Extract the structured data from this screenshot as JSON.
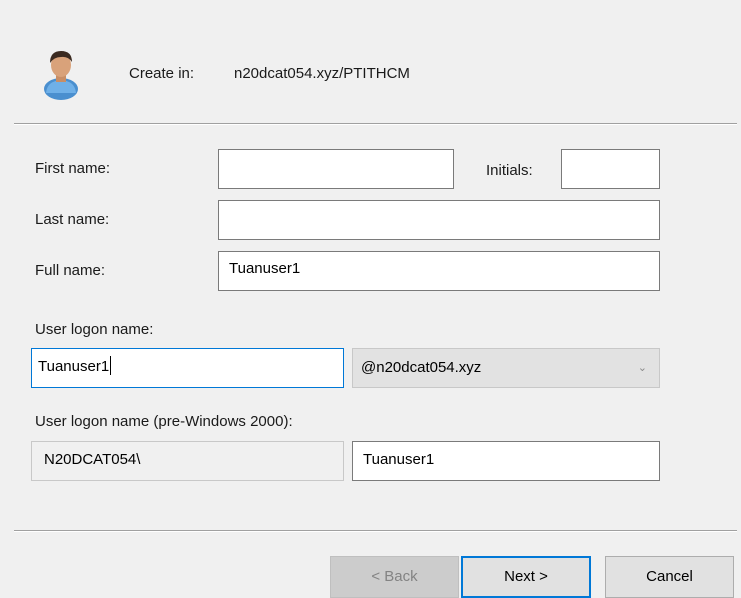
{
  "header": {
    "icon": "user-icon",
    "create_in_label": "Create in:",
    "create_in_path": "n20dcat054.xyz/PTITHCM"
  },
  "form": {
    "first_name": {
      "label": "First name:",
      "value": ""
    },
    "initials": {
      "label": "Initials:",
      "value": ""
    },
    "last_name": {
      "label": "Last name:",
      "value": ""
    },
    "full_name": {
      "label": "Full name:",
      "value": "Tuanuser1"
    },
    "logon_name": {
      "label": "User logon name:",
      "value": "Tuanuser1",
      "domain_suffix": "@n20dcat054.xyz",
      "dropdown_icon": "chevron-down-icon"
    },
    "pre2000": {
      "label": "User logon name (pre-Windows 2000):",
      "domain_prefix": "N20DCAT054\\",
      "value": "Tuanuser1"
    }
  },
  "buttons": {
    "back": "< Back",
    "next": "Next >",
    "cancel": "Cancel"
  },
  "colors": {
    "focus_border": "#0078d7",
    "dialog_background": "#f0f0f0"
  }
}
